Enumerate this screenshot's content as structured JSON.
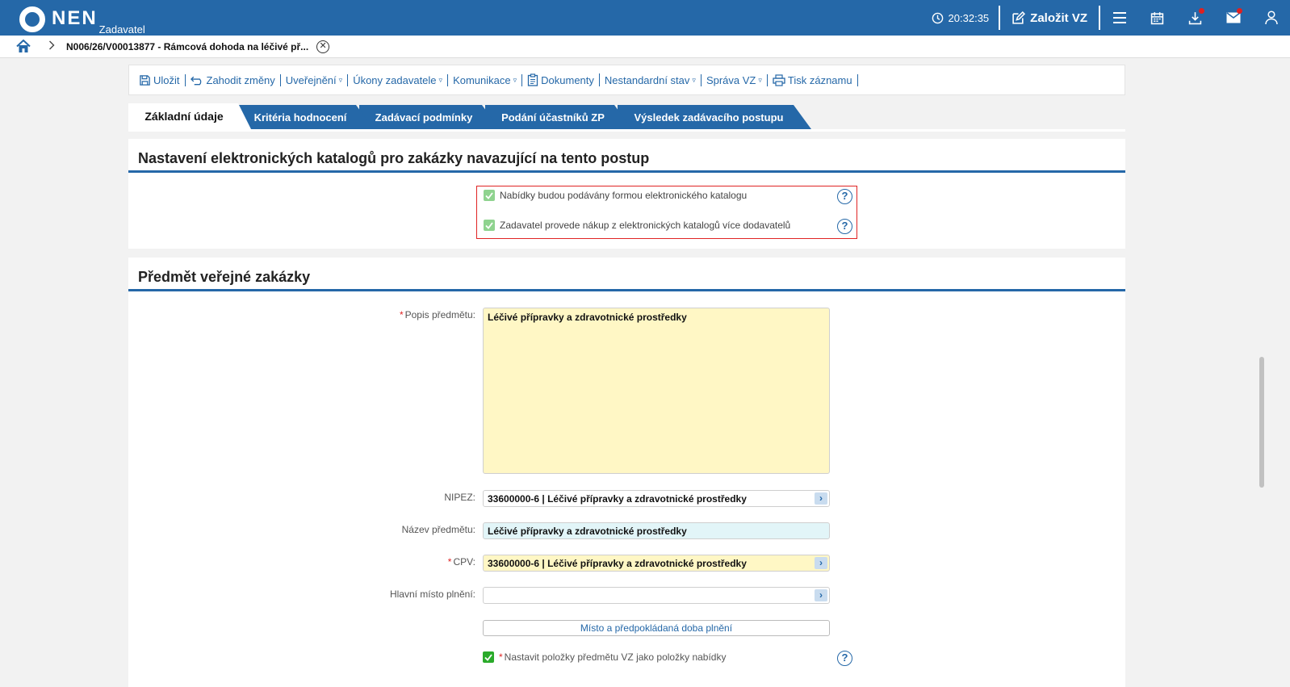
{
  "header": {
    "logo_text": "NEN",
    "logo_sub": "Zadavatel",
    "time": "20:32:35",
    "new_vz_label": "Založit VZ"
  },
  "breadcrumb": {
    "title": "N006/26/V00013877 - Rámcová dohoda na léčivé př..."
  },
  "toolbar": {
    "items": [
      {
        "label": "Uložit",
        "icon": "save-icon"
      },
      {
        "label": "Zahodit změny",
        "icon": "undo-icon"
      },
      {
        "label": "Uveřejnění",
        "dropdown": true
      },
      {
        "label": "Úkony zadavatele",
        "dropdown": true
      },
      {
        "label": "Komunikace",
        "dropdown": true
      },
      {
        "label": "Dokumenty",
        "icon": "clipboard-icon"
      },
      {
        "label": "Nestandardní stav",
        "dropdown": true
      },
      {
        "label": "Správa VZ",
        "dropdown": true
      },
      {
        "label": "Tisk záznamu",
        "icon": "print-icon"
      }
    ],
    "dropdown_glyph": "▿"
  },
  "tabs": [
    {
      "label": "Základní údaje",
      "active": true
    },
    {
      "label": "Kritéria hodnocení"
    },
    {
      "label": "Zadávací podmínky"
    },
    {
      "label": "Podání účastníků ZP"
    },
    {
      "label": "Výsledek zadávacího postupu"
    }
  ],
  "catalog_section": {
    "title": "Nastavení elektronických katalogů pro zakázky navazující na tento postup",
    "options": [
      {
        "label": "Nabídky budou podávány formou elektronického katalogu",
        "checked": true
      },
      {
        "label": "Zadavatel provede nákup z elektronických katalogů více dodavatelů",
        "checked": true
      }
    ]
  },
  "subject_section": {
    "title": "Předmět veřejné zakázky",
    "required_mark": "*",
    "fields": {
      "popis": {
        "label": "Popis předmětu:",
        "value": "Léčivé přípravky a zdravotnické prostředky",
        "required": true
      },
      "nipez": {
        "label": "NIPEZ:",
        "value": "33600000-6 | Léčivé přípravky a zdravotnické prostředky"
      },
      "nazev": {
        "label": "Název předmětu:",
        "value": "Léčivé přípravky a zdravotnické prostředky"
      },
      "cpv": {
        "label": "CPV:",
        "value": "33600000-6 | Léčivé přípravky a zdravotnické prostředky",
        "required": true
      },
      "misto": {
        "label": "Hlavní místo plnění:",
        "value": ""
      }
    },
    "misto_button": "Místo a předpokládaná doba plnění",
    "items_checkbox": {
      "label": "Nastavit položky předmětu VZ jako položky nabídky",
      "checked": true,
      "required": true
    }
  },
  "colors": {
    "brand_blue": "#2568a8",
    "required_red": "#e02424",
    "field_yellow": "#fff7c5",
    "field_cyan": "#e2f5f8"
  }
}
